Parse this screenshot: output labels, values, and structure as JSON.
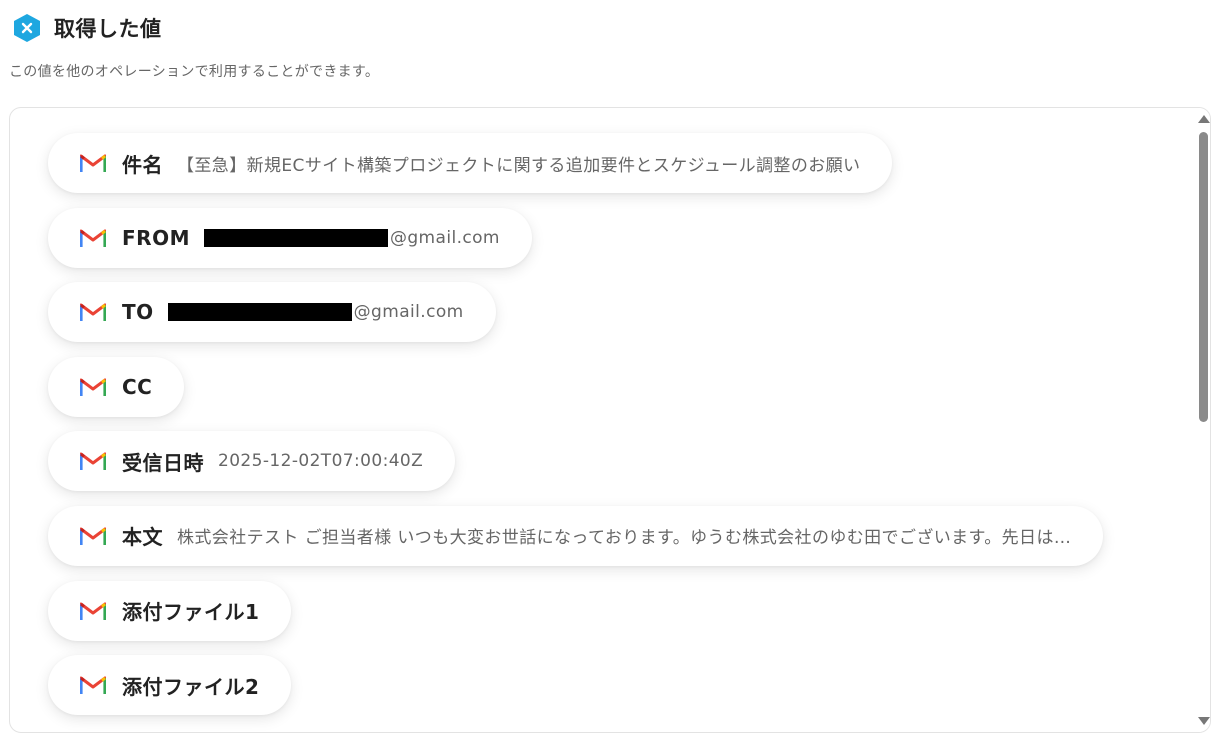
{
  "header": {
    "title": "取得した値",
    "subtitle": "この値を他のオペレーションで利用することができます。"
  },
  "fields": [
    {
      "label": "件名",
      "value": "【至急】新規ECサイト構築プロジェクトに関する追加要件とスケジュール調整のお願い"
    },
    {
      "label": "FROM",
      "value": "@gmail.com"
    },
    {
      "label": "TO",
      "value": "@gmail.com"
    },
    {
      "label": "CC",
      "value": ""
    },
    {
      "label": "受信日時",
      "value": "2025-12-02T07:00:40Z"
    },
    {
      "label": "本文",
      "value": "株式会社テスト ご担当者様 いつも大変お世話になっております。ゆうむ株式会社のゆむ田でございます。先日は…"
    },
    {
      "label": "添付ファイル1",
      "value": ""
    },
    {
      "label": "添付ファイル2",
      "value": ""
    }
  ],
  "icons": {
    "header_logo": "yoom-logo-icon",
    "field_icon": "gmail-icon"
  },
  "colors": {
    "logo": "#1ea7e0",
    "redaction": "#000000",
    "scrollbar_thumb": "#8a8a8a"
  }
}
